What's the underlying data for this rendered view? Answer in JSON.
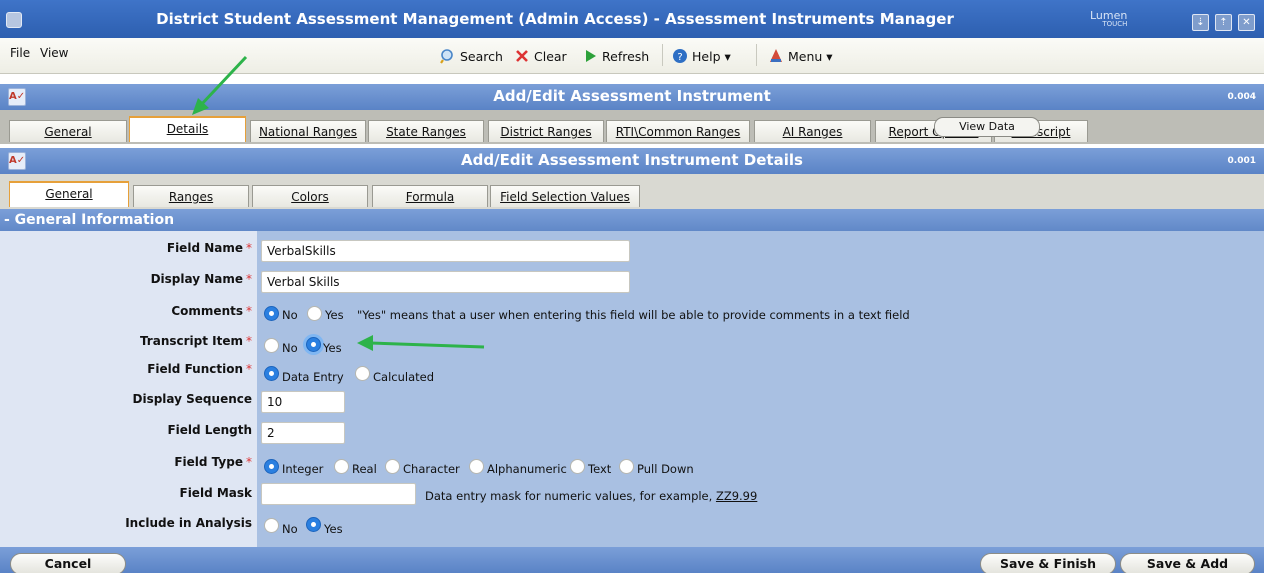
{
  "window": {
    "title": "District Student Assessment Management (Admin Access) - Assessment Instruments Manager",
    "logo_main": "Lumen",
    "logo_sub": "TOUCH"
  },
  "menubar": {
    "file": "File",
    "view": "View",
    "toolbar": {
      "search": "Search",
      "clear": "Clear",
      "refresh": "Refresh",
      "help": "Help ▾",
      "menu": "Menu ▾"
    }
  },
  "panel1": {
    "title": "Add/Edit Assessment Instrument",
    "version": "0.004",
    "tabs": [
      "General",
      "Details",
      "National Ranges",
      "State Ranges",
      "District Ranges",
      "RTI\\Common Ranges",
      "AI Ranges",
      "Report Options",
      "Transcript"
    ],
    "active_tab": "Details",
    "tooltip": "View Data"
  },
  "panel2": {
    "title": "Add/Edit Assessment Instrument Details",
    "version": "0.001",
    "tabs": [
      "General",
      "Ranges",
      "Colors",
      "Formula",
      "Field Selection Values"
    ],
    "active_tab": "General"
  },
  "section": {
    "title": "- General Information"
  },
  "form": {
    "field_name": {
      "label": "Field Name",
      "value": "VerbalSkills"
    },
    "display_name": {
      "label": "Display Name",
      "value": "Verbal Skills"
    },
    "comments": {
      "label": "Comments",
      "options": [
        "No",
        "Yes"
      ],
      "selected": "No",
      "note": "\"Yes\" means that a user when entering this field will be able to provide comments in a text field"
    },
    "transcript_item": {
      "label": "Transcript Item",
      "options": [
        "No",
        "Yes"
      ],
      "selected": "Yes"
    },
    "field_function": {
      "label": "Field Function",
      "options": [
        "Data Entry",
        "Calculated"
      ],
      "selected": "Data Entry"
    },
    "display_sequence": {
      "label": "Display Sequence",
      "value": "10"
    },
    "field_length": {
      "label": "Field Length",
      "value": "2"
    },
    "field_type": {
      "label": "Field Type",
      "options": [
        "Integer",
        "Real",
        "Character",
        "Alphanumeric",
        "Text",
        "Pull Down"
      ],
      "selected": "Integer"
    },
    "field_mask": {
      "label": "Field Mask",
      "value": "",
      "note": "Data entry mask for numeric values, for example,",
      "example": "ZZ9.99"
    },
    "include_analysis": {
      "label": "Include in Analysis",
      "options": [
        "No",
        "Yes"
      ],
      "selected": "Yes"
    }
  },
  "buttons": {
    "cancel": "Cancel",
    "save_finish": "Save & Finish",
    "save_add": "Save & Add"
  },
  "colors": {
    "title_blue": "#2d5fb0",
    "header_blue": "#6b90cc",
    "form_blue": "#a9c0e2",
    "annotation_green": "#2db34a",
    "active_tab_border": "#e6a03a"
  }
}
